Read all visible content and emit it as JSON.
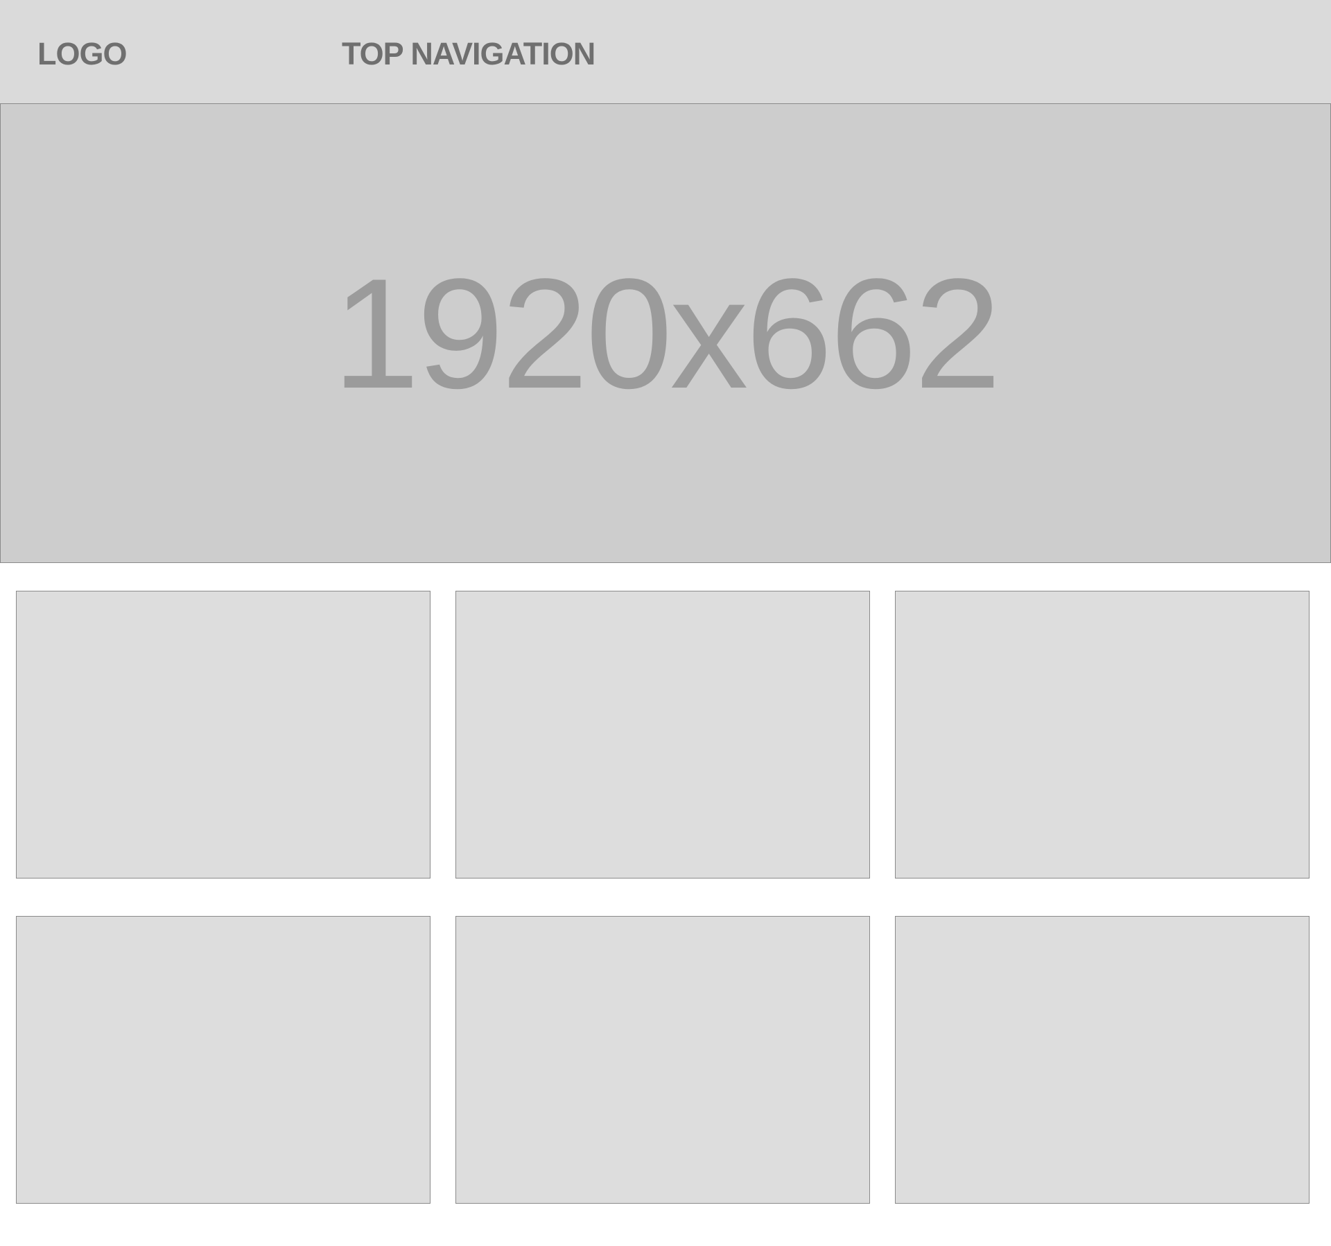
{
  "header": {
    "logo": "LOGO",
    "nav_label": "TOP NAVIGATION"
  },
  "hero": {
    "placeholder_label": "1920x662"
  },
  "tiles": [
    {
      "label": ""
    },
    {
      "label": ""
    },
    {
      "label": ""
    },
    {
      "label": ""
    },
    {
      "label": ""
    },
    {
      "label": ""
    }
  ],
  "colors": {
    "header_bg": "#dadada",
    "hero_bg": "#cdcdcd",
    "tile_bg": "#dddddd",
    "text": "#6f6f6f",
    "placeholder_text": "#9b9b9b",
    "border": "#8a8a8a"
  }
}
